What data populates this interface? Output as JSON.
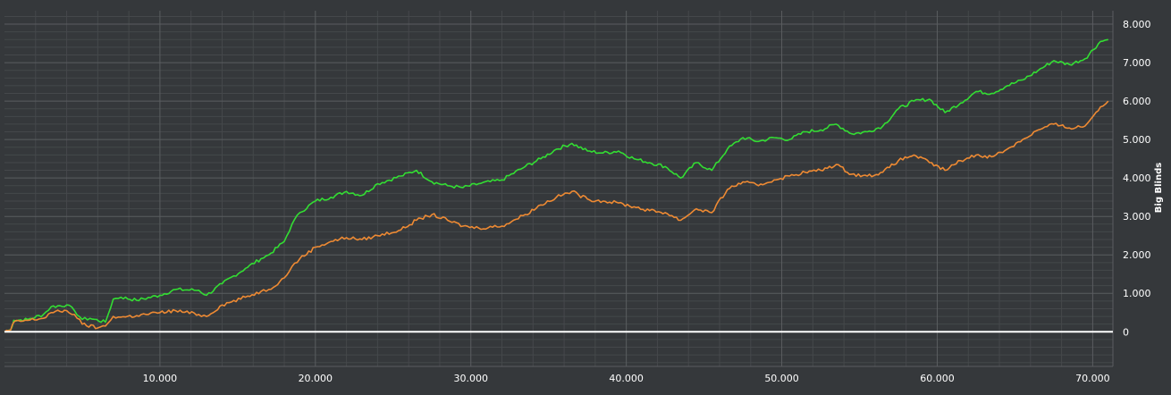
{
  "colors": {
    "background": "#35383b",
    "grid_major": "#5a5d60",
    "grid_minor": "#45484b",
    "zero_line": "#ffffff",
    "tick_text": "#ffffff"
  },
  "chart_data": {
    "type": "line",
    "title": "",
    "xlabel": "",
    "ylabel": "Big Blinds",
    "xlim": [
      0,
      71300
    ],
    "ylim": [
      -900,
      8350
    ],
    "x_ticks": [
      10000,
      20000,
      30000,
      40000,
      50000,
      60000,
      70000
    ],
    "x_tick_labels": [
      "10.000",
      "20.000",
      "30.000",
      "40.000",
      "50.000",
      "60.000",
      "70.000"
    ],
    "y_ticks": [
      0,
      1000,
      2000,
      3000,
      4000,
      5000,
      6000,
      7000,
      8000
    ],
    "y_tick_labels": [
      "0",
      "1.000",
      "2.000",
      "3.000",
      "4.000",
      "5.000",
      "6.000",
      "7.000",
      "8.000"
    ],
    "y_axis_position": "right",
    "grid": true,
    "legend": false,
    "series": [
      {
        "color": "#33dd33",
        "x": [
          0,
          400,
          600,
          1500,
          2500,
          3000,
          4000,
          4500,
          5000,
          5500,
          6500,
          7000,
          7500,
          8500,
          10000,
          11000,
          12500,
          13000,
          14000,
          15500,
          16500,
          17000,
          18000,
          18500,
          19000,
          20000,
          21000,
          22000,
          23000,
          24000,
          25500,
          26500,
          27500,
          28500,
          29500,
          30500,
          32000,
          33500,
          34500,
          35500,
          36500,
          37500,
          38500,
          39500,
          40500,
          41500,
          42500,
          43500,
          44500,
          45500,
          46500,
          47500,
          48500,
          49500,
          50500,
          51500,
          52500,
          53500,
          54500,
          55500,
          56500,
          57500,
          58500,
          59500,
          60500,
          61500,
          62500,
          63500,
          64500,
          65500,
          66500,
          67500,
          68500,
          69500,
          70500,
          71000
        ],
        "y": [
          0,
          50,
          300,
          320,
          450,
          650,
          700,
          550,
          320,
          350,
          250,
          850,
          900,
          820,
          950,
          1100,
          1080,
          950,
          1250,
          1650,
          1900,
          2000,
          2350,
          2800,
          3100,
          3400,
          3500,
          3650,
          3550,
          3850,
          4050,
          4200,
          3900,
          3800,
          3750,
          3850,
          3950,
          4300,
          4500,
          4750,
          4900,
          4700,
          4650,
          4700,
          4500,
          4400,
          4300,
          4000,
          4400,
          4200,
          4750,
          5050,
          4950,
          5050,
          5000,
          5200,
          5250,
          5400,
          5150,
          5200,
          5350,
          5800,
          6000,
          6050,
          5700,
          5950,
          6250,
          6200,
          6400,
          6550,
          6800,
          7050,
          6950,
          7100,
          7550,
          7600
        ]
      },
      {
        "color": "#ee8a33",
        "x": [
          0,
          400,
          600,
          1500,
          2500,
          3000,
          4000,
          4500,
          5000,
          6000,
          6500,
          7000,
          7500,
          8500,
          10000,
          11000,
          12500,
          13000,
          14000,
          15500,
          16500,
          17000,
          18000,
          18500,
          19000,
          20000,
          21000,
          22000,
          23000,
          24000,
          25500,
          26500,
          27500,
          28500,
          29500,
          30500,
          32000,
          33500,
          34500,
          35500,
          36500,
          37500,
          38500,
          39500,
          40500,
          41500,
          42500,
          43500,
          44500,
          45500,
          46500,
          47500,
          48500,
          49500,
          50500,
          51500,
          52500,
          53500,
          54500,
          55500,
          56500,
          57500,
          58500,
          59500,
          60500,
          61500,
          62500,
          63500,
          64500,
          65500,
          66500,
          67500,
          68500,
          69500,
          70500,
          71000
        ],
        "y": [
          0,
          50,
          250,
          300,
          350,
          500,
          550,
          450,
          200,
          100,
          150,
          400,
          380,
          420,
          500,
          550,
          450,
          400,
          700,
          900,
          1050,
          1100,
          1400,
          1700,
          1900,
          2200,
          2350,
          2450,
          2400,
          2500,
          2650,
          2900,
          3050,
          2900,
          2750,
          2700,
          2750,
          3050,
          3300,
          3500,
          3650,
          3450,
          3400,
          3350,
          3250,
          3150,
          3100,
          2900,
          3200,
          3100,
          3700,
          3900,
          3800,
          3950,
          4050,
          4150,
          4200,
          4350,
          4100,
          4050,
          4150,
          4450,
          4600,
          4400,
          4200,
          4450,
          4600,
          4550,
          4750,
          5000,
          5250,
          5400,
          5300,
          5350,
          5850,
          6000
        ]
      }
    ]
  }
}
